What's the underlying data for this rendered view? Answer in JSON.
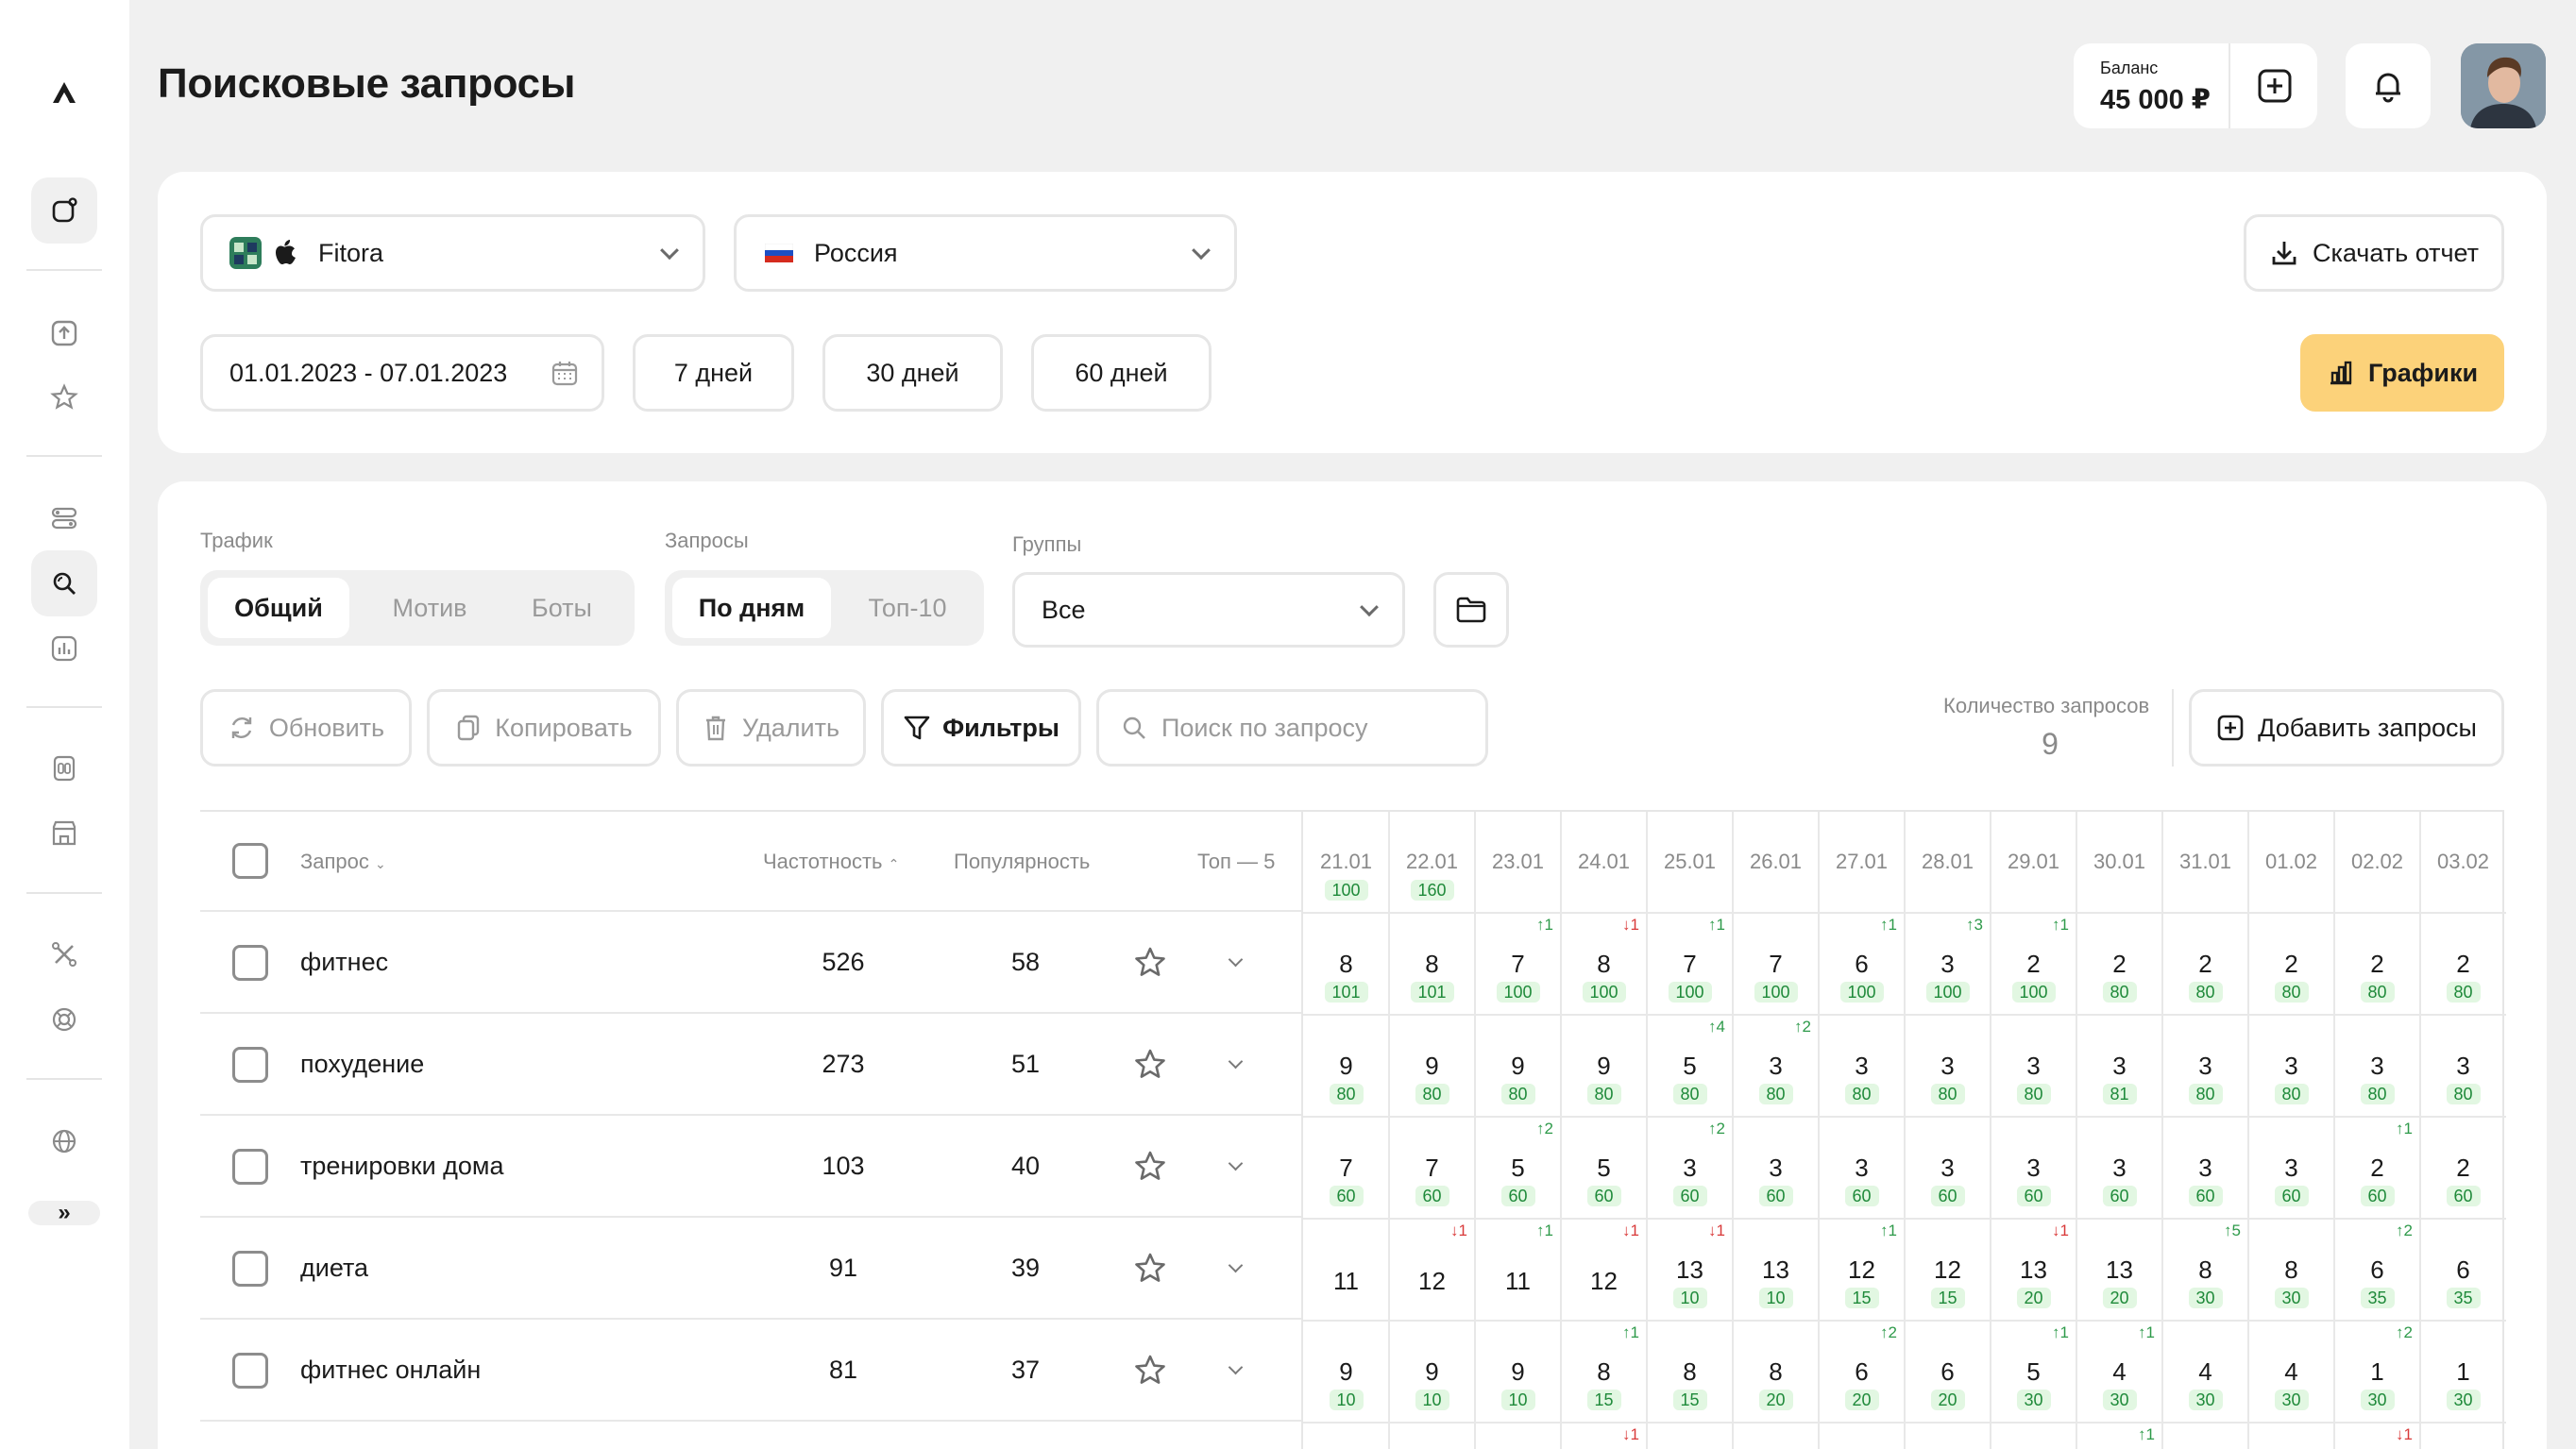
{
  "page": {
    "title": "Поисковые запросы"
  },
  "balance": {
    "label": "Баланс",
    "value": "45 000 ₽"
  },
  "sidebar": {
    "icons": [
      "logo-icon",
      "apps-icon",
      "upload-icon",
      "star-icon",
      "toggles-icon",
      "search-icon",
      "chart-icon",
      "compare-icon",
      "store-icon",
      "tools-icon",
      "support-icon",
      "globe-icon"
    ],
    "expand": "»"
  },
  "filters": {
    "app": "Fitora",
    "country": "Россия",
    "date_range": "01.01.2023 - 07.01.2023",
    "period_buttons": [
      "7 дней",
      "30 дней",
      "60 дней"
    ],
    "download": "Скачать отчет",
    "charts": "Графики"
  },
  "controls": {
    "traffic_label": "Трафик",
    "traffic_options": [
      "Общий",
      "Мотив",
      "Боты"
    ],
    "queries_label": "Запросы",
    "queries_options": [
      "По дням",
      "Топ-10"
    ],
    "groups_label": "Группы",
    "groups_value": "Все",
    "refresh": "Обновить",
    "copy": "Копировать",
    "delete": "Удалить",
    "filters": "Фильтры",
    "search_placeholder": "Поиск по запросу",
    "count_label": "Количество запросов",
    "count_value": "9",
    "add_queries": "Добавить запросы"
  },
  "table": {
    "headers": {
      "query": "Запрос",
      "frequency": "Частотность",
      "popularity": "Популярность",
      "top": "Топ — 5"
    },
    "dates": [
      "21.01",
      "22.01",
      "23.01",
      "24.01",
      "25.01",
      "26.01",
      "27.01",
      "28.01",
      "29.01",
      "30.01",
      "31.01",
      "01.02",
      "02.02",
      "03.02"
    ],
    "date_badges": [
      "100",
      "160",
      "",
      "",
      "",
      "",
      "",
      "",
      "",
      "",
      "",
      "",
      "",
      ""
    ],
    "rows": [
      {
        "query": "фитнес",
        "frequency": "526",
        "popularity": "58",
        "positions": [
          "8",
          "8",
          "7",
          "8",
          "7",
          "7",
          "6",
          "3",
          "2",
          "2",
          "2",
          "2",
          "2",
          "2"
        ],
        "badges": [
          "101",
          "101",
          "100",
          "100",
          "100",
          "100",
          "100",
          "100",
          "100",
          "80",
          "80",
          "80",
          "80",
          "80"
        ],
        "deltas": [
          "",
          "",
          "↑1",
          "↓1",
          "↑1",
          "",
          "↑1",
          "↑3",
          "↑1",
          "",
          "",
          "",
          "",
          ""
        ]
      },
      {
        "query": "похудение",
        "frequency": "273",
        "popularity": "51",
        "positions": [
          "9",
          "9",
          "9",
          "9",
          "5",
          "3",
          "3",
          "3",
          "3",
          "3",
          "3",
          "3",
          "3",
          "3"
        ],
        "badges": [
          "80",
          "80",
          "80",
          "80",
          "80",
          "80",
          "80",
          "80",
          "80",
          "81",
          "80",
          "80",
          "80",
          "80"
        ],
        "deltas": [
          "",
          "",
          "",
          "",
          "↑4",
          "↑2",
          "",
          "",
          "",
          "",
          "",
          "",
          "",
          ""
        ]
      },
      {
        "query": "тренировки дома",
        "frequency": "103",
        "popularity": "40",
        "positions": [
          "7",
          "7",
          "5",
          "5",
          "3",
          "3",
          "3",
          "3",
          "3",
          "3",
          "3",
          "3",
          "2",
          "2"
        ],
        "badges": [
          "60",
          "60",
          "60",
          "60",
          "60",
          "60",
          "60",
          "60",
          "60",
          "60",
          "60",
          "60",
          "60",
          "60"
        ],
        "deltas": [
          "",
          "",
          "↑2",
          "",
          "↑2",
          "",
          "",
          "",
          "",
          "",
          "",
          "",
          "↑1",
          ""
        ]
      },
      {
        "query": "диета",
        "frequency": "91",
        "popularity": "39",
        "positions": [
          "11",
          "12",
          "11",
          "12",
          "13",
          "13",
          "12",
          "12",
          "13",
          "13",
          "8",
          "8",
          "6",
          "6"
        ],
        "badges": [
          "",
          "",
          "",
          "",
          "10",
          "10",
          "15",
          "15",
          "20",
          "20",
          "30",
          "30",
          "35",
          "35"
        ],
        "deltas": [
          "",
          "↓1",
          "↑1",
          "↓1",
          "↓1",
          "",
          "↑1",
          "",
          "↓1",
          "",
          "↑5",
          "",
          "↑2",
          ""
        ]
      },
      {
        "query": "фитнес онлайн",
        "frequency": "81",
        "popularity": "37",
        "positions": [
          "9",
          "9",
          "9",
          "8",
          "8",
          "8",
          "6",
          "6",
          "5",
          "4",
          "4",
          "4",
          "1",
          "1"
        ],
        "badges": [
          "10",
          "10",
          "10",
          "15",
          "15",
          "20",
          "20",
          "20",
          "30",
          "30",
          "30",
          "30",
          "30",
          "30"
        ],
        "deltas": [
          "",
          "",
          "",
          "↑1",
          "",
          "",
          "↑2",
          "",
          "↑1",
          "↑1",
          "",
          "",
          "↑2",
          ""
        ]
      }
    ],
    "next_row_deltas": [
      "",
      "",
      "",
      "↓1",
      "",
      "",
      "",
      "",
      "",
      "↑1",
      "",
      "",
      "↓1",
      ""
    ]
  }
}
